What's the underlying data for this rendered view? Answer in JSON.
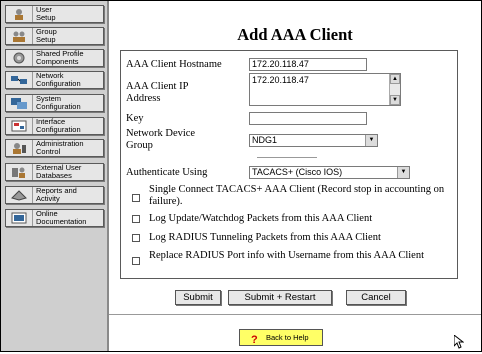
{
  "sidebar": {
    "items": [
      {
        "label": "User\nSetup",
        "icon": "user-icon"
      },
      {
        "label": "Group\nSetup",
        "icon": "group-icon"
      },
      {
        "label": "Shared Profile\nComponents",
        "icon": "shared-profile-icon"
      },
      {
        "label": "Network\nConfiguration",
        "icon": "network-icon"
      },
      {
        "label": "System\nConfiguration",
        "icon": "system-icon"
      },
      {
        "label": "Interface\nConfiguration",
        "icon": "interface-icon"
      },
      {
        "label": "Administration\nControl",
        "icon": "admin-icon"
      },
      {
        "label": "External User\nDatabases",
        "icon": "database-icon"
      },
      {
        "label": "Reports and\nActivity",
        "icon": "reports-icon"
      },
      {
        "label": "Online\nDocumentation",
        "icon": "documentation-icon"
      }
    ]
  },
  "main": {
    "title": "Add AAA Client",
    "form": {
      "hostname_label": "AAA Client Hostname",
      "hostname_value": "172.20.118.47",
      "ip_label": "AAA Client IP\nAddress",
      "ip_value": "172.20.118.47",
      "key_label": "Key",
      "key_value": "",
      "ndg_label": "Network Device\nGroup",
      "ndg_value": "NDG1",
      "auth_label": "Authenticate Using",
      "auth_value": "TACACS+ (Cisco IOS)",
      "checkboxes": [
        {
          "label": "Single Connect TACACS+ AAA Client (Record stop in accounting on failure).",
          "checked": false
        },
        {
          "label": "Log Update/Watchdog Packets from this AAA Client",
          "checked": false
        },
        {
          "label": "Log RADIUS Tunneling Packets from this AAA Client",
          "checked": false
        },
        {
          "label": "Replace RADIUS Port info with Username from this AAA Client",
          "checked": false
        }
      ]
    },
    "buttons": {
      "submit": "Submit",
      "submit_restart": "Submit + Restart",
      "cancel": "Cancel"
    },
    "help": "Back to Help"
  },
  "colors": {
    "sidebar_bg": "#cfcfcf",
    "help_bg": "#ffff66"
  }
}
